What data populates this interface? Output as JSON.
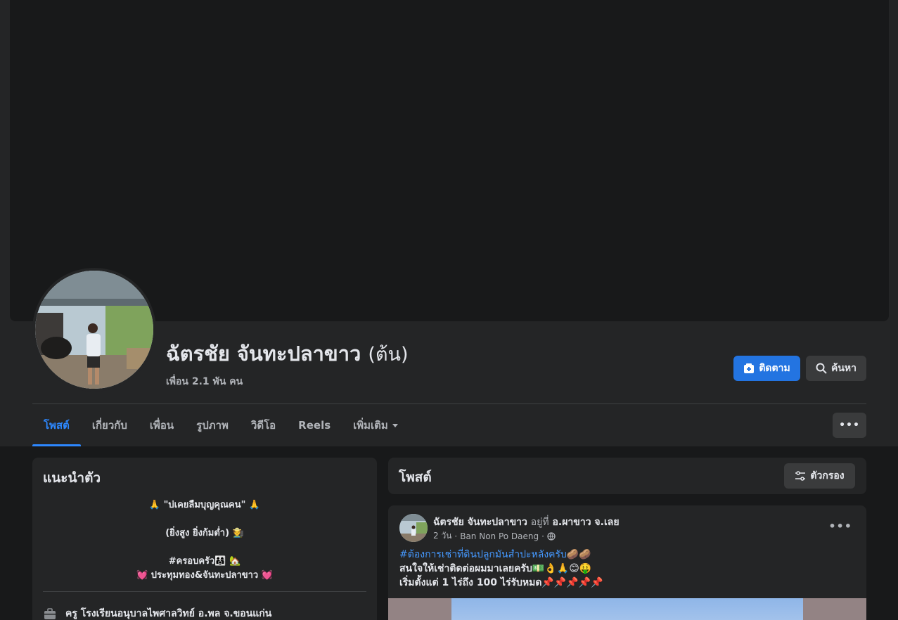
{
  "profile": {
    "name": "ฉัตรชัย จันทะปลาขาว",
    "nickname": "(ต้น)",
    "friends": "เพื่อน 2.1 พัน คน"
  },
  "actions": {
    "follow_label": "ติดตาม",
    "search_label": "ค้นหา",
    "more_label": "•••"
  },
  "tabs": [
    {
      "label": "โพสต์"
    },
    {
      "label": "เกี่ยวกับ"
    },
    {
      "label": "เพื่อน"
    },
    {
      "label": "รูปภาพ"
    },
    {
      "label": "วิดีโอ"
    },
    {
      "label": "Reels"
    },
    {
      "label": "เพิ่มเติม"
    }
  ],
  "intro": {
    "title": "แนะนำตัว",
    "bio_line1": "🙏 \"บ่เคยลืมบุญคุณคน\" 🙏",
    "bio_line2": "(ยิ่งสูง ยิ่งก้มต่ำ) 🧑‍🌾",
    "bio_line3": "#ครอบครัว👨‍👩‍👧 🏡",
    "bio_line4": "💓 ประทุมทอง&จันทะปลาขาว 💓",
    "work": "ครู โรงเรียนอนุบาลไพศาลวิทย์ อ.พล จ.ขอนแก่น"
  },
  "posts_section": {
    "title": "โพสต์",
    "filter_label": "ตัวกรอง"
  },
  "post": {
    "author": "ฉัตรชัย จันทะปลาขาว",
    "at_text": "อยู่ที่",
    "location": "อ.ผาขาว จ.เลย",
    "time": "2 วัน",
    "place": "Ban Non Po Daeng",
    "hashtag": "#ต้องการเช่าที่ดินปลูกมันสำปะหลังครับ🥔🥔",
    "line2": "สนใจให้เช่าติดต่อผมมาเลยครับ💵👌🙏😊🤑",
    "line3": "เริ่มตั้งแต่ 1 ไร่ถึง 100 ไร่รับหมด📌📌📌📌📌"
  },
  "colors": {
    "accent": "#2374e1",
    "tab_active": "#2d88ff",
    "surface": "#242526",
    "background": "#18191a"
  }
}
